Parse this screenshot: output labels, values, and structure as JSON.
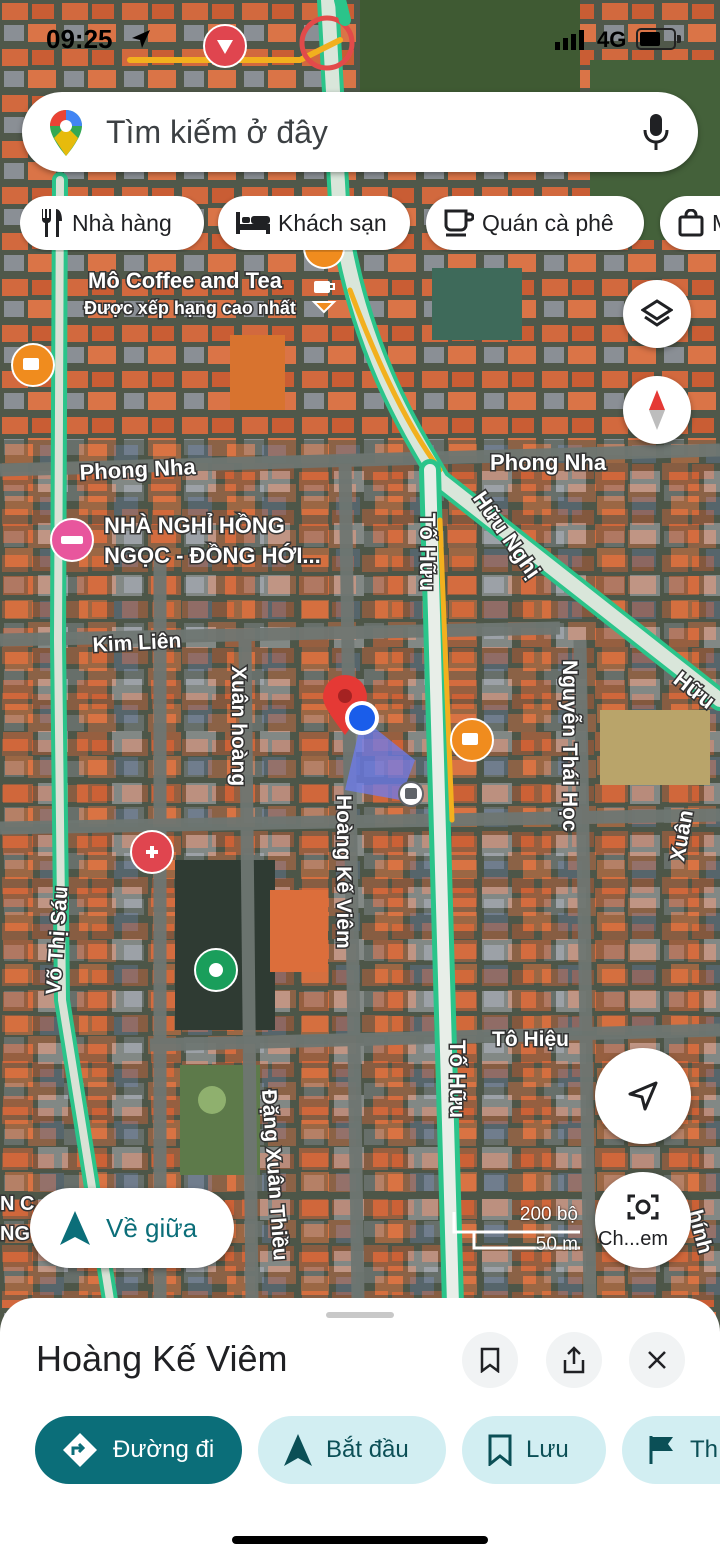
{
  "status_bar": {
    "time": "09:25",
    "network": "4G"
  },
  "search": {
    "placeholder": "Tìm kiếm ở đây"
  },
  "chips": [
    {
      "label": "Nhà hàng",
      "icon": "fork-knife-icon"
    },
    {
      "label": "Khách sạn",
      "icon": "bed-icon"
    },
    {
      "label": "Quán cà phê",
      "icon": "coffee-cup-icon"
    },
    {
      "label": "M",
      "icon": "shopping-bag-icon"
    }
  ],
  "map": {
    "pois": [
      {
        "name": "Mô Coffee and Tea",
        "subtitle": "Được xếp hạng cao nhất"
      },
      {
        "name": "NHÀ NGHỈ HỒNG",
        "name_line2": "NGỌC - ĐỒNG HỚI..."
      }
    ],
    "streets": {
      "phong_nha_left": "Phong Nha",
      "phong_nha_right": "Phong Nha",
      "huu_nghi": "Hữu Nghị",
      "huu_edge": "Hữu",
      "to_huu_top": "Tố Hữu",
      "to_huu_bottom": "Tố Hữu",
      "kim_lien": "Kim Liên",
      "xuan_hoang": "Xuân hoàng",
      "hoang_ke_viem": "Hoàng Kế Viêm",
      "nguyen_thai_hoc": "Nguyễn Thái Học",
      "xuan_edge": "Xuân",
      "vo_thi_sau": "Võ Thị Sáu",
      "to_hieu": "Tô Hiệu",
      "dang_xuan_thieu": "Đặng Xuân Thiều",
      "chinh_edge": "hính",
      "edge_left": "N C",
      "edge_left2": "NG"
    },
    "scale": {
      "top": "200 bộ",
      "bottom": "50 m"
    }
  },
  "buttons": {
    "recenter": "Về giữa",
    "camera": "Ch...em"
  },
  "place_sheet": {
    "title": "Hoàng Kế Viêm",
    "actions": [
      {
        "label": "Đường đi",
        "icon": "directions-icon"
      },
      {
        "label": "Bắt đầu",
        "icon": "navigation-arrow-icon"
      },
      {
        "label": "Lưu",
        "icon": "bookmark-icon"
      },
      {
        "label": "Th",
        "icon": "flag-icon"
      }
    ]
  },
  "colors": {
    "accent": "#0b6e79",
    "accent_light": "#d2eef2",
    "road_green": "#2bc48a",
    "road_yellow": "#f2b01e"
  }
}
